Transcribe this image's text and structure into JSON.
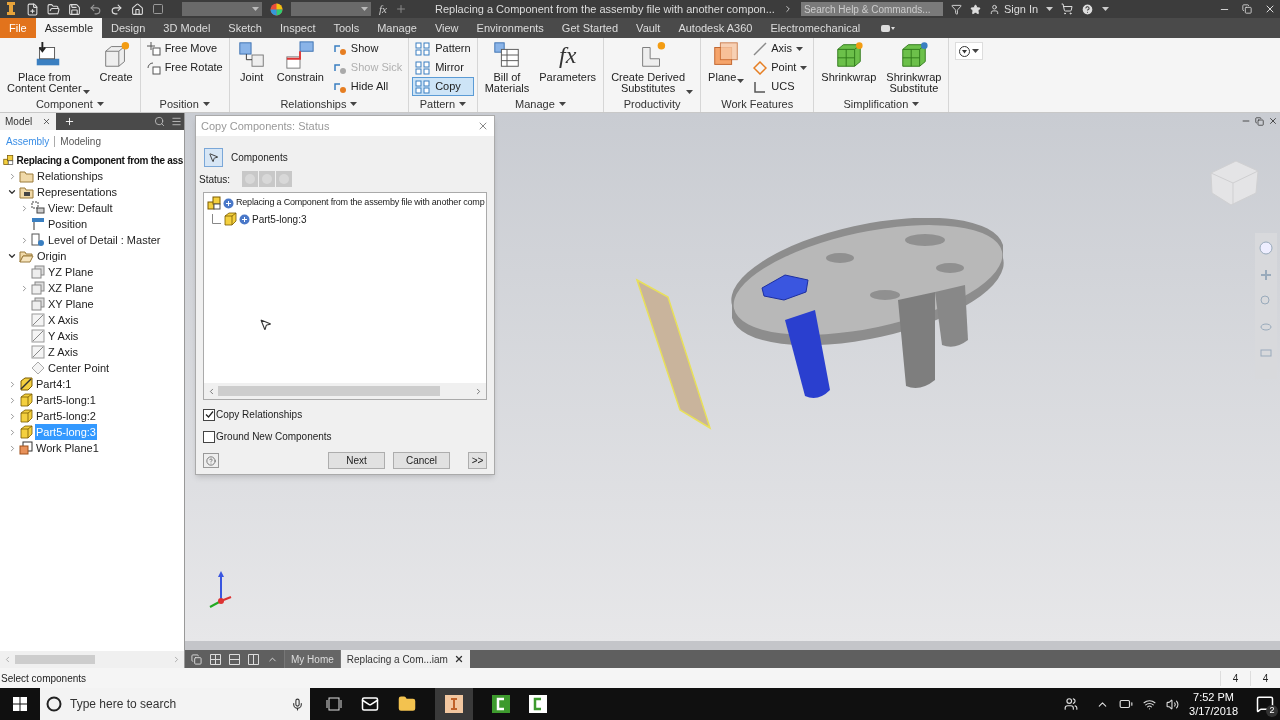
{
  "title_bar": {
    "fx_glyph": "fx",
    "title": "Replacing a Component from the assemby file with another compon...",
    "search_placeholder": "Search Help & Commands...",
    "sign_in": "Sign In"
  },
  "ribbon_tabs": [
    {
      "label": "File",
      "kind": "file",
      "selected": false
    },
    {
      "label": "Assemble",
      "kind": "tab",
      "selected": true
    },
    {
      "label": "Design",
      "kind": "tab",
      "selected": false
    },
    {
      "label": "3D Model",
      "kind": "tab",
      "selected": false
    },
    {
      "label": "Sketch",
      "kind": "tab",
      "selected": false
    },
    {
      "label": "Inspect",
      "kind": "tab",
      "selected": false
    },
    {
      "label": "Tools",
      "kind": "tab",
      "selected": false
    },
    {
      "label": "Manage",
      "kind": "tab",
      "selected": false
    },
    {
      "label": "View",
      "kind": "tab",
      "selected": false
    },
    {
      "label": "Environments",
      "kind": "tab",
      "selected": false
    },
    {
      "label": "Get Started",
      "kind": "tab",
      "selected": false
    },
    {
      "label": "Vault",
      "kind": "tab",
      "selected": false
    },
    {
      "label": "Autodesk A360",
      "kind": "tab",
      "selected": false
    },
    {
      "label": "Electromechanical",
      "kind": "tab",
      "selected": false
    }
  ],
  "ribbon_groups": [
    {
      "label": "Component",
      "has_menu": true,
      "buttons": [
        {
          "label": "Place from\nContent Center",
          "kind": "large",
          "active": false,
          "disabled": false,
          "dropdown": true
        },
        {
          "label": "Create",
          "kind": "large",
          "active": false,
          "disabled": false,
          "dropdown": false
        }
      ]
    },
    {
      "label": "Position",
      "has_menu": true,
      "buttons": [
        {
          "label": "Free Move",
          "kind": "small",
          "active": false,
          "disabled": false,
          "dropdown": false
        },
        {
          "label": "Free Rotate",
          "kind": "small",
          "active": false,
          "disabled": false,
          "dropdown": false
        }
      ]
    },
    {
      "label": "Relationships",
      "has_menu": true,
      "buttons": [
        {
          "label": "Joint",
          "kind": "large",
          "active": false,
          "disabled": false,
          "dropdown": false
        },
        {
          "label": "Constrain",
          "kind": "large",
          "active": false,
          "disabled": false,
          "dropdown": false
        },
        {
          "label": "Show",
          "kind": "small",
          "active": false,
          "disabled": false,
          "dropdown": false
        },
        {
          "label": "Show Sick",
          "kind": "small",
          "active": false,
          "disabled": true,
          "dropdown": false
        },
        {
          "label": "Hide All",
          "kind": "small",
          "active": false,
          "disabled": false,
          "dropdown": false
        }
      ]
    },
    {
      "label": "Pattern",
      "has_menu": true,
      "buttons": [
        {
          "label": "Pattern",
          "kind": "small",
          "active": false,
          "disabled": false,
          "dropdown": false
        },
        {
          "label": "Mirror",
          "kind": "small",
          "active": false,
          "disabled": false,
          "dropdown": false
        },
        {
          "label": "Copy",
          "kind": "small",
          "active": true,
          "disabled": false,
          "dropdown": false
        }
      ]
    },
    {
      "label": "Manage",
      "has_menu": true,
      "buttons": [
        {
          "label": "Bill of\nMaterials",
          "kind": "large",
          "active": false,
          "disabled": false,
          "dropdown": false
        },
        {
          "label": "Parameters",
          "kind": "large",
          "glyph": "fx",
          "active": false,
          "disabled": false,
          "dropdown": false
        }
      ]
    },
    {
      "label": "Productivity",
      "has_menu": false,
      "buttons": [
        {
          "label": "Create Derived\nSubstitutes",
          "kind": "large",
          "active": false,
          "disabled": false,
          "dropdown": true
        }
      ]
    },
    {
      "label": "Work Features",
      "has_menu": false,
      "buttons": [
        {
          "label": "Plane",
          "kind": "large",
          "active": false,
          "disabled": false,
          "dropdown": true
        },
        {
          "label": "Axis",
          "kind": "small",
          "active": false,
          "disabled": false,
          "dropdown": true
        },
        {
          "label": "Point",
          "kind": "small",
          "active": false,
          "disabled": false,
          "dropdown": true
        },
        {
          "label": "UCS",
          "kind": "small",
          "active": false,
          "disabled": false,
          "dropdown": false
        }
      ]
    },
    {
      "label": "Simplification",
      "has_menu": true,
      "buttons": [
        {
          "label": "Shrinkwrap",
          "kind": "large",
          "active": false,
          "disabled": false,
          "dropdown": false
        },
        {
          "label": "Shrinkwrap\nSubstitute",
          "kind": "large",
          "active": false,
          "disabled": false,
          "dropdown": false
        }
      ]
    }
  ],
  "browser": {
    "tab": "Model",
    "modes": [
      {
        "label": "Assembly",
        "selected": true
      },
      {
        "label": "Modeling",
        "selected": false
      }
    ],
    "tree": [
      {
        "label": "Replacing a Component from the ass",
        "kind": "assembly",
        "selected": false,
        "children": [
          {
            "label": "Relationships",
            "kind": "folder",
            "expanded": false,
            "selected": false
          },
          {
            "label": "Representations",
            "kind": "representations",
            "expanded": true,
            "selected": false,
            "children": [
              {
                "label": "View: Default",
                "kind": "view",
                "expanded": false,
                "selected": false
              },
              {
                "label": "Position",
                "kind": "position",
                "selected": false
              },
              {
                "label": "Level of Detail : Master",
                "kind": "lod",
                "expanded": false,
                "selected": false
              }
            ]
          },
          {
            "label": "Origin",
            "kind": "open-folder",
            "expanded": true,
            "selected": false,
            "children": [
              {
                "label": "YZ Plane",
                "kind": "plane",
                "selected": false
              },
              {
                "label": "XZ Plane",
                "kind": "plane",
                "expanded": false,
                "selected": false
              },
              {
                "label": "XY Plane",
                "kind": "plane",
                "selected": false
              },
              {
                "label": "X Axis",
                "kind": "axis",
                "selected": false
              },
              {
                "label": "Y Axis",
                "kind": "axis",
                "selected": false
              },
              {
                "label": "Z Axis",
                "kind": "axis",
                "selected": false
              },
              {
                "label": "Center Point",
                "kind": "point",
                "selected": false
              }
            ]
          },
          {
            "label": "Part4:1",
            "kind": "grounded-part",
            "expanded": false,
            "selected": false
          },
          {
            "label": "Part5-long:1",
            "kind": "part",
            "expanded": false,
            "selected": false
          },
          {
            "label": "Part5-long:2",
            "kind": "part",
            "expanded": false,
            "selected": false
          },
          {
            "label": "Part5-long:3",
            "kind": "part",
            "expanded": false,
            "selected": true
          },
          {
            "label": "Work Plane1",
            "kind": "work-plane",
            "expanded": false,
            "selected": false
          }
        ]
      }
    ]
  },
  "dialog": {
    "title": "Copy Components: Status",
    "select_button": "Components",
    "status_label": "Status:",
    "tree": [
      {
        "label": "Replacing a Component from the assemby file with another comp",
        "kind": "assembly",
        "children": [
          {
            "label": "Part5-long:3",
            "kind": "part"
          }
        ]
      }
    ],
    "options": [
      {
        "label": "Copy Relationships",
        "checked": true
      },
      {
        "label": "Ground New Components",
        "checked": false
      }
    ],
    "buttons": [
      "Next",
      "Cancel",
      ">>"
    ]
  },
  "document_tabs": [
    {
      "label": "My Home",
      "selected": false,
      "closable": false
    },
    {
      "label": "Replacing a Com...iam",
      "selected": true,
      "closable": true
    }
  ],
  "status_bar": {
    "prompt": "Select components",
    "counts": [
      "4",
      "4"
    ]
  },
  "taskbar": {
    "search_placeholder": "Type here to search",
    "time": "7:52 PM",
    "date": "3/17/2018",
    "notifications": "2"
  }
}
